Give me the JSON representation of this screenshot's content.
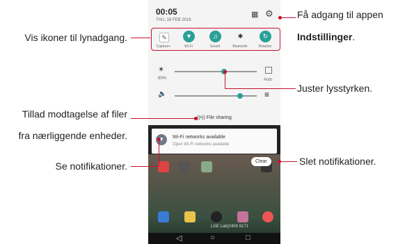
{
  "callouts": {
    "settings_line1": "Få adgang til appen",
    "settings_line2_bold": "Indstillinger",
    "settings_line2_end": ".",
    "quick_access": "Vis ikoner til lynadgang.",
    "brightness": "Juster lysstyrken.",
    "file_sharing_line1": "Tillad modtagelse af filer",
    "file_sharing_line2": "fra nærliggende enheder.",
    "notifications": "Se notifikationer.",
    "clear": "Slet notifikationer."
  },
  "phone": {
    "time": "00:05",
    "date": "THU, 18 FEB 2016",
    "quick_settings": [
      "Capture+",
      "Wi-Fi",
      "Sound",
      "Bluetooth",
      "Rotation"
    ],
    "brightness_percent": "60%",
    "brightness_level": 0.6,
    "auto_label": "Auto",
    "volume_level": 0.8,
    "file_sharing_label": "File sharing",
    "notification_title": "Wi-Fi networks available",
    "notification_subtitle": "Open Wi-Fi networks available",
    "clear_label": "Clear",
    "carrier": "LGE Lab(2400 6171",
    "nav": {
      "back": "◁",
      "home": "○",
      "recent": "□"
    }
  },
  "icons": [
    "settings-gear-icon",
    "grid-icon",
    "capture-icon",
    "wifi-icon",
    "sound-icon",
    "bluetooth-icon",
    "rotation-icon",
    "brightness-icon",
    "volume-icon",
    "equalizer-icon",
    "file-sharing-icon",
    "wifi-notification-icon"
  ],
  "colors": {
    "callout_line": "#c8102e",
    "accent": "#2aa198"
  }
}
